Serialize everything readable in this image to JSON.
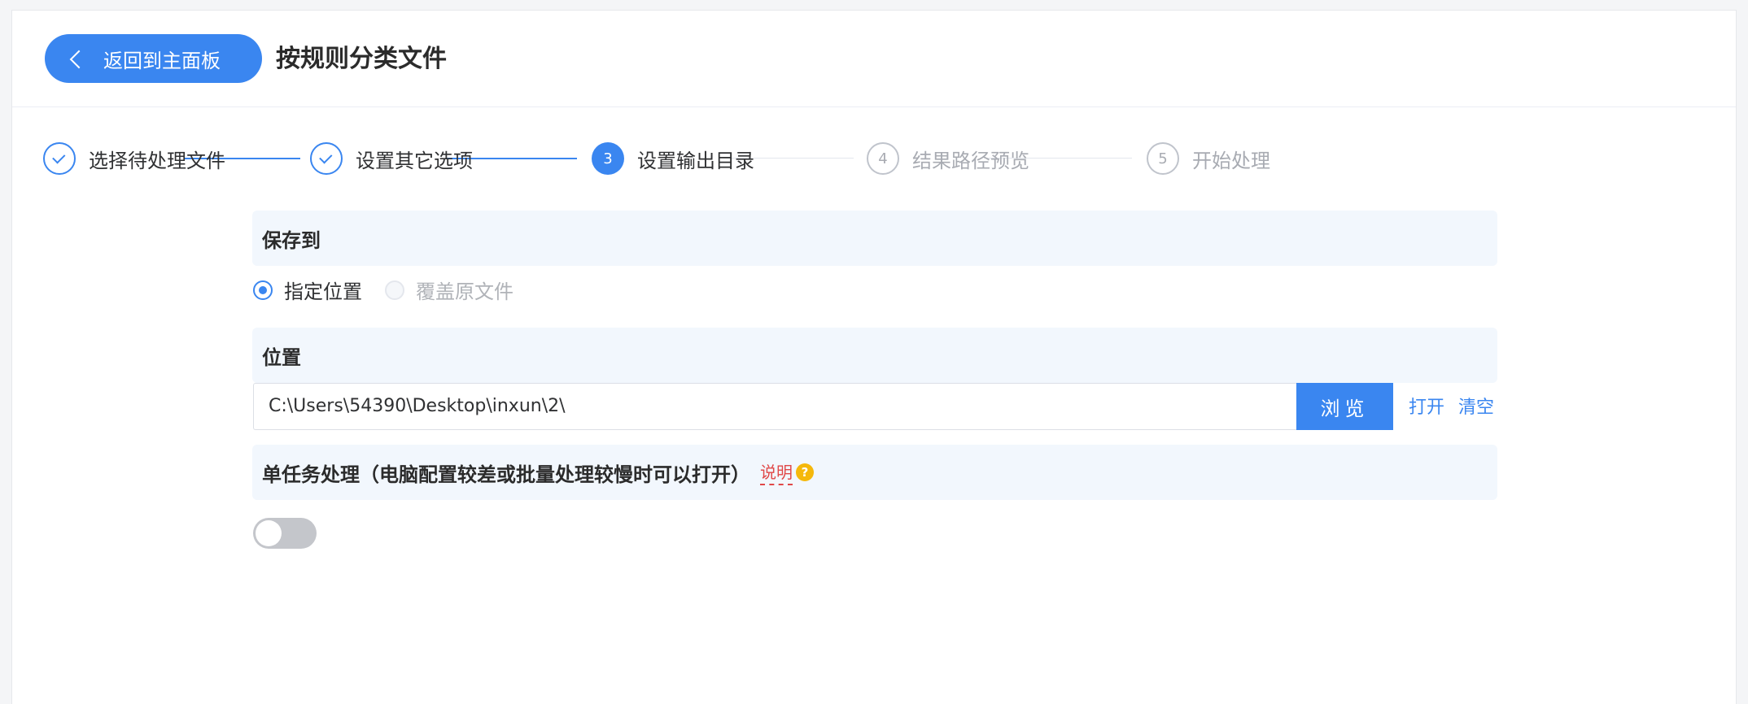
{
  "header": {
    "back_label": "返回到主面板",
    "title": "按规则分类文件"
  },
  "steps": [
    {
      "label": "选择待处理文件",
      "status": "done",
      "number": "1"
    },
    {
      "label": "设置其它选项",
      "status": "done",
      "number": "2"
    },
    {
      "label": "设置输出目录",
      "status": "active",
      "number": "3"
    },
    {
      "label": "结果路径预览",
      "status": "wait",
      "number": "4"
    },
    {
      "label": "开始处理",
      "status": "wait",
      "number": "5"
    }
  ],
  "save_to": {
    "heading": "保存到",
    "options": [
      {
        "label": "指定位置",
        "selected": true,
        "disabled": false
      },
      {
        "label": "覆盖原文件",
        "selected": false,
        "disabled": true
      }
    ]
  },
  "location": {
    "heading": "位置",
    "path_value": "C:\\Users\\54390\\Desktop\\inxun\\2\\",
    "browse_label": "浏览",
    "open_label": "打开",
    "clear_label": "清空"
  },
  "single_task": {
    "heading": "单任务处理（电脑配置较差或批量处理较慢时可以打开）",
    "help_label": "说明",
    "help_icon": "?",
    "enabled": false
  },
  "colors": {
    "accent": "#3a86f0",
    "section_bg": "#f2f7fd",
    "help_red": "#e04848",
    "help_yellow": "#f5b80b"
  }
}
